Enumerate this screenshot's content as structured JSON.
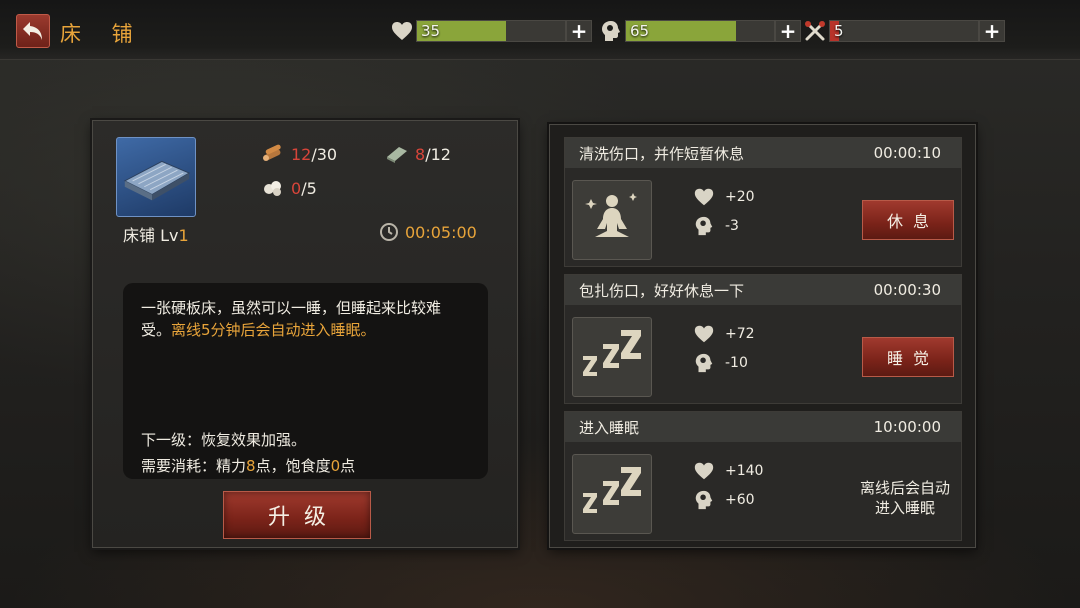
{
  "header": {
    "title": "床 铺",
    "stats": [
      {
        "name": "health",
        "value": "35",
        "fill_fraction": 0.6,
        "color": "#8aa53a"
      },
      {
        "name": "mind",
        "value": "65",
        "fill_fraction": 0.74,
        "color": "#8aa53a"
      },
      {
        "name": "tools",
        "value": "5",
        "fill_fraction": 0.06,
        "color": "#b8332a"
      }
    ],
    "plus_label": "+"
  },
  "item": {
    "name": "床铺 Lv",
    "level": "1",
    "resources": [
      {
        "icon": "wood-icon",
        "have": "12",
        "need": "/30"
      },
      {
        "icon": "cloth-icon",
        "have": "8",
        "need": "/12"
      },
      {
        "icon": "cotton-icon",
        "have": "0",
        "need": "/5"
      }
    ],
    "timer": "00:05:00",
    "description": "一张硬板床，虽然可以一睡，但睡起来比较难受。",
    "description_highlight": "离线5分钟后会自动进入睡眠。",
    "next_level": "下一级：恢复效果加强。",
    "cost_prefix": "需要消耗：精力",
    "cost_energy": "8",
    "cost_mid": "点，饱食度",
    "cost_food": "0",
    "cost_suffix": "点",
    "upgrade_label": "升级"
  },
  "rest_options": [
    {
      "title": "清洗伤口，并作短暂休息",
      "time": "00:00:10",
      "icon": "meditate-icon",
      "health": "+20",
      "mind": "-3",
      "action": "休息"
    },
    {
      "title": "包扎伤口，好好休息一下",
      "time": "00:00:30",
      "icon": "sleep-zzz-icon",
      "health": "+72",
      "mind": "-10",
      "action": "睡觉"
    },
    {
      "title": "进入睡眠",
      "time": "10:00:00",
      "icon": "sleep-zzz-icon",
      "health": "+140",
      "mind": "+60",
      "note": "离线后会自动进入睡眠"
    }
  ]
}
